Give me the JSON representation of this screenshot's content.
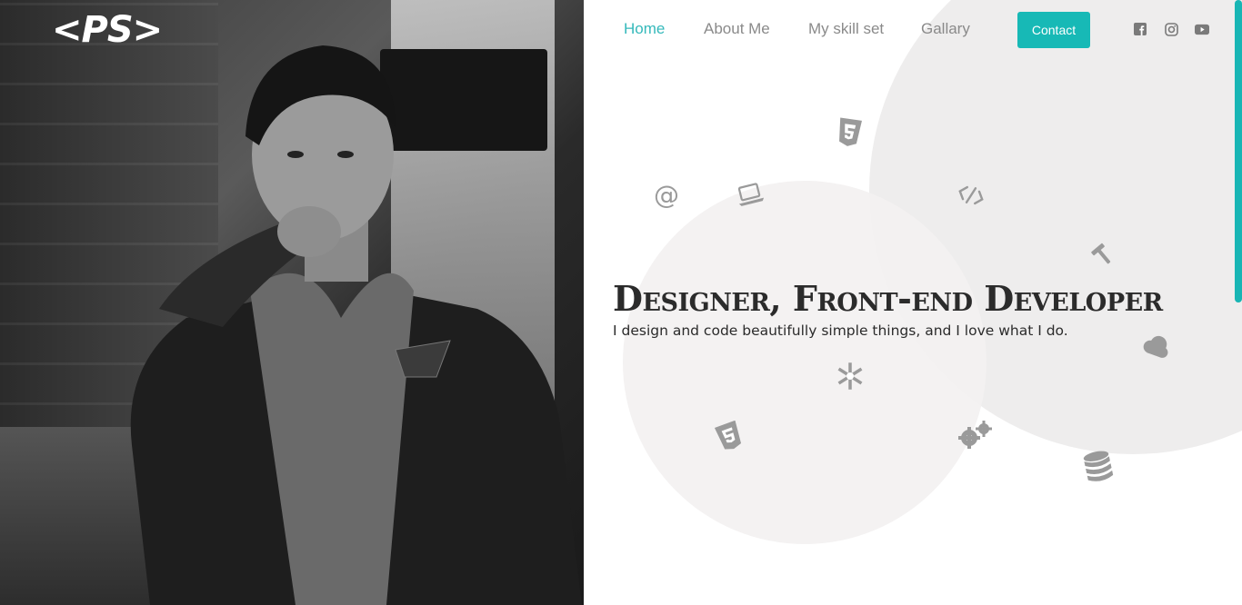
{
  "logo": {
    "text": "<PS>"
  },
  "nav": {
    "items": [
      {
        "label": "Home",
        "active": true
      },
      {
        "label": "About Me",
        "active": false
      },
      {
        "label": "My skill set",
        "active": false
      },
      {
        "label": "Gallary",
        "active": false
      }
    ],
    "contact_label": "Contact"
  },
  "social": [
    {
      "icon": "facebook-icon"
    },
    {
      "icon": "instagram-icon"
    },
    {
      "icon": "youtube-icon"
    }
  ],
  "hero": {
    "headline": "Designer, Front-end Developer",
    "subline": "I design and code beautifully simple things, and I love what I do."
  },
  "decorative_icons": [
    "css3-icon",
    "at-sign-icon",
    "laptop-icon",
    "code-icon",
    "tools-icon",
    "cloud-icon",
    "asterisk-icon",
    "html5-icon",
    "gears-icon",
    "database-icon"
  ],
  "colors": {
    "accent": "#17b9b6",
    "active_link": "#35b9bb",
    "text": "#2b2b2b",
    "muted": "#8a8a8a",
    "icon": "#999999"
  }
}
